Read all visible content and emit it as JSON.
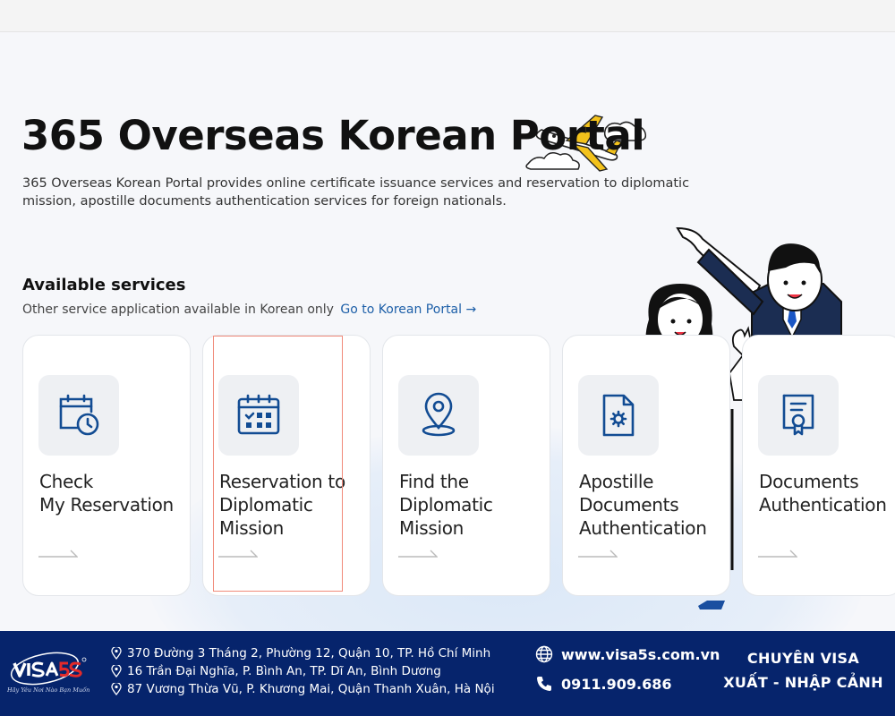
{
  "page": {
    "title": "365 Overseas Korean Portal",
    "description": "365 Overseas Korean Portal provides online certificate issuance services and reservation to diplomatic mission, apostille documents authentication services for foreign nationals."
  },
  "services": {
    "heading": "Available services",
    "note": "Other service application available in Korean only",
    "link": "Go to Korean Portal →",
    "cards": [
      {
        "label": "Check\nMy Reservation",
        "icon": "calendar-clock-icon"
      },
      {
        "label": "Reservation to\nDiplomatic\nMission",
        "icon": "calendar-grid-icon"
      },
      {
        "label": "Find the\nDiplomatic\nMission",
        "icon": "map-pin-icon"
      },
      {
        "label": "Apostille\nDocuments\nAuthentication",
        "icon": "document-gear-icon"
      },
      {
        "label": "Documents\nAuthentication",
        "icon": "certificate-icon"
      }
    ]
  },
  "footer": {
    "brand": "VISA5S",
    "tagline": "Hãy Yêu Nơi Nào Bạn Muốn",
    "addresses": [
      "370 Đường 3 Tháng 2, Phường 12, Quận 10, TP. Hồ Chí Minh",
      "16 Trần Đại Nghĩa, P. Bình An, TP. Dĩ An, Bình Dương",
      "87 Vương Thừa Vũ, P. Khương Mai, Quận Thanh Xuân, Hà Nội"
    ],
    "website": "www.visa5s.com.vn",
    "phone": "0911.909.686",
    "slogan_line1": "CHUYÊN VISA",
    "slogan_line2": "XUẤT - NHẬP CẢNH"
  },
  "colors": {
    "icon_blue": "#124c93",
    "link_blue": "#1d5fa8",
    "footer_navy": "#06246c",
    "highlight": "#f08a7a"
  }
}
